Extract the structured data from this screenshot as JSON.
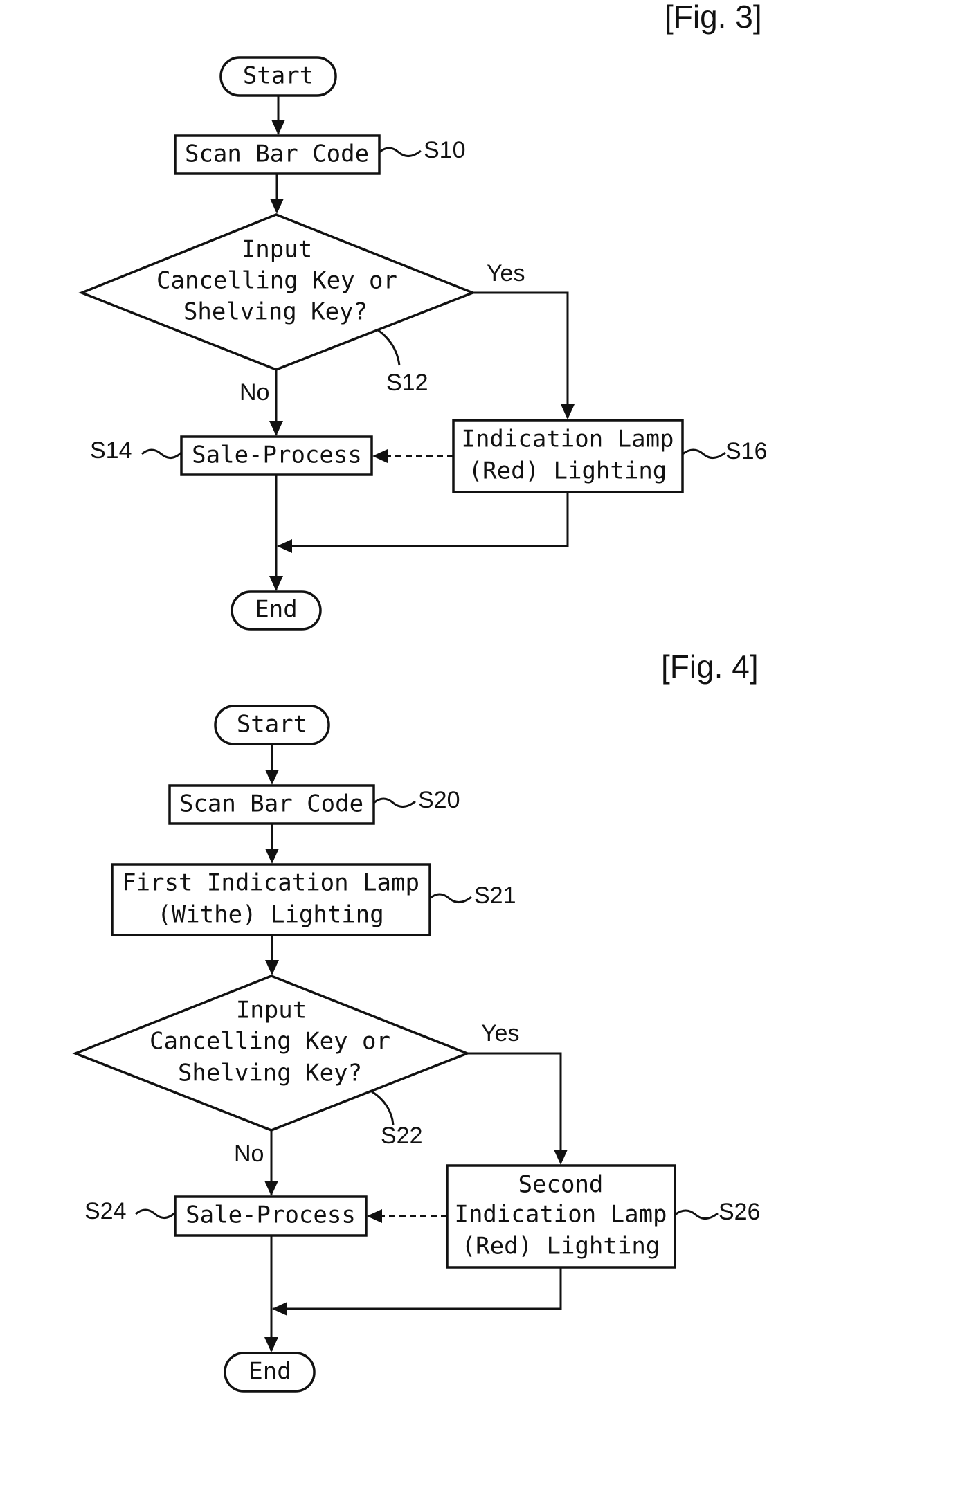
{
  "fig3": {
    "label": "[Fig. 3]",
    "start": "Start",
    "scan": "Scan Bar Code",
    "scan_ref": "S10",
    "decision": [
      "Input",
      "Cancelling Key or",
      "Shelving Key?"
    ],
    "decision_ref": "S12",
    "yes": "Yes",
    "no": "No",
    "sale": "Sale-Process",
    "sale_ref": "S14",
    "lamp": [
      "Indication Lamp",
      "(Red) Lighting"
    ],
    "lamp_ref": "S16",
    "end": "End"
  },
  "fig4": {
    "label": "[Fig. 4]",
    "start": "Start",
    "scan": "Scan Bar Code",
    "scan_ref": "S20",
    "first_lamp": [
      "First Indication Lamp",
      "(Withe) Lighting"
    ],
    "first_lamp_ref": "S21",
    "decision": [
      "Input",
      "Cancelling Key or",
      "Shelving Key?"
    ],
    "decision_ref": "S22",
    "yes": "Yes",
    "no": "No",
    "sale": "Sale-Process",
    "sale_ref": "S24",
    "lamp": [
      "Second",
      "Indication Lamp",
      "(Red) Lighting"
    ],
    "lamp_ref": "S26",
    "end": "End"
  }
}
